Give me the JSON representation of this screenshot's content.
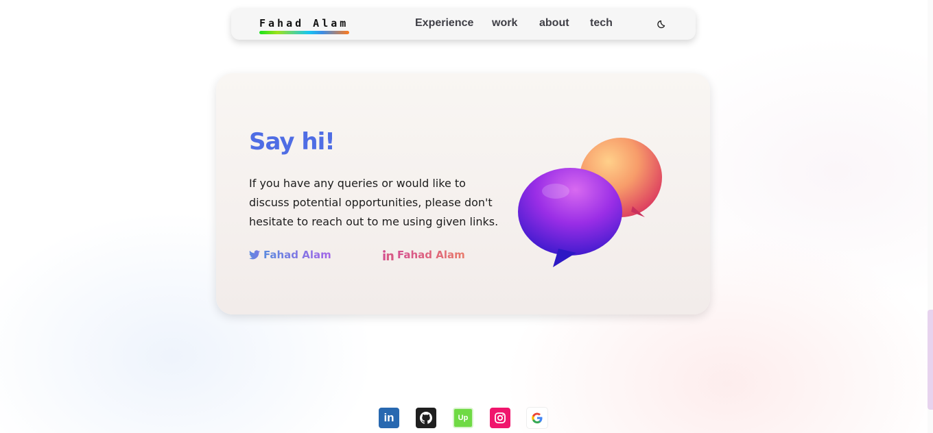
{
  "nav": {
    "brand": "Fahad Alam",
    "links": [
      {
        "label": "Experience"
      },
      {
        "label": "work"
      },
      {
        "label": "about"
      },
      {
        "label": "tech"
      }
    ],
    "theme_icon": "moon-icon"
  },
  "contact": {
    "title": "Say hi!",
    "text": "If you have any queries or would like to discuss potential opportunities, please don't hesitate to reach out to me using given links.",
    "twitter": {
      "icon": "twitter-icon",
      "label": "Fahad Alam"
    },
    "linkedin": {
      "icon": "linkedin-icon",
      "label": "Fahad Alam"
    },
    "illustration": "chat-bubbles-illustration"
  },
  "footer": {
    "icons": [
      {
        "name": "linkedin-icon",
        "color": "#2868b0",
        "text": "in"
      },
      {
        "name": "github-icon",
        "color": "#1f1f1f"
      },
      {
        "name": "upwork-icon",
        "color": "#6fda44",
        "text": "Up"
      },
      {
        "name": "instagram-icon",
        "color": "#f0156c"
      },
      {
        "name": "google-icon",
        "color": "#ffffff",
        "text": "G"
      }
    ]
  },
  "colors": {
    "accent": "#4f6de4",
    "twitter_gradient": [
      "#5b8ade",
      "#a466e8"
    ],
    "linkedin_gradient": [
      "#d5508f",
      "#e87a6a"
    ]
  }
}
